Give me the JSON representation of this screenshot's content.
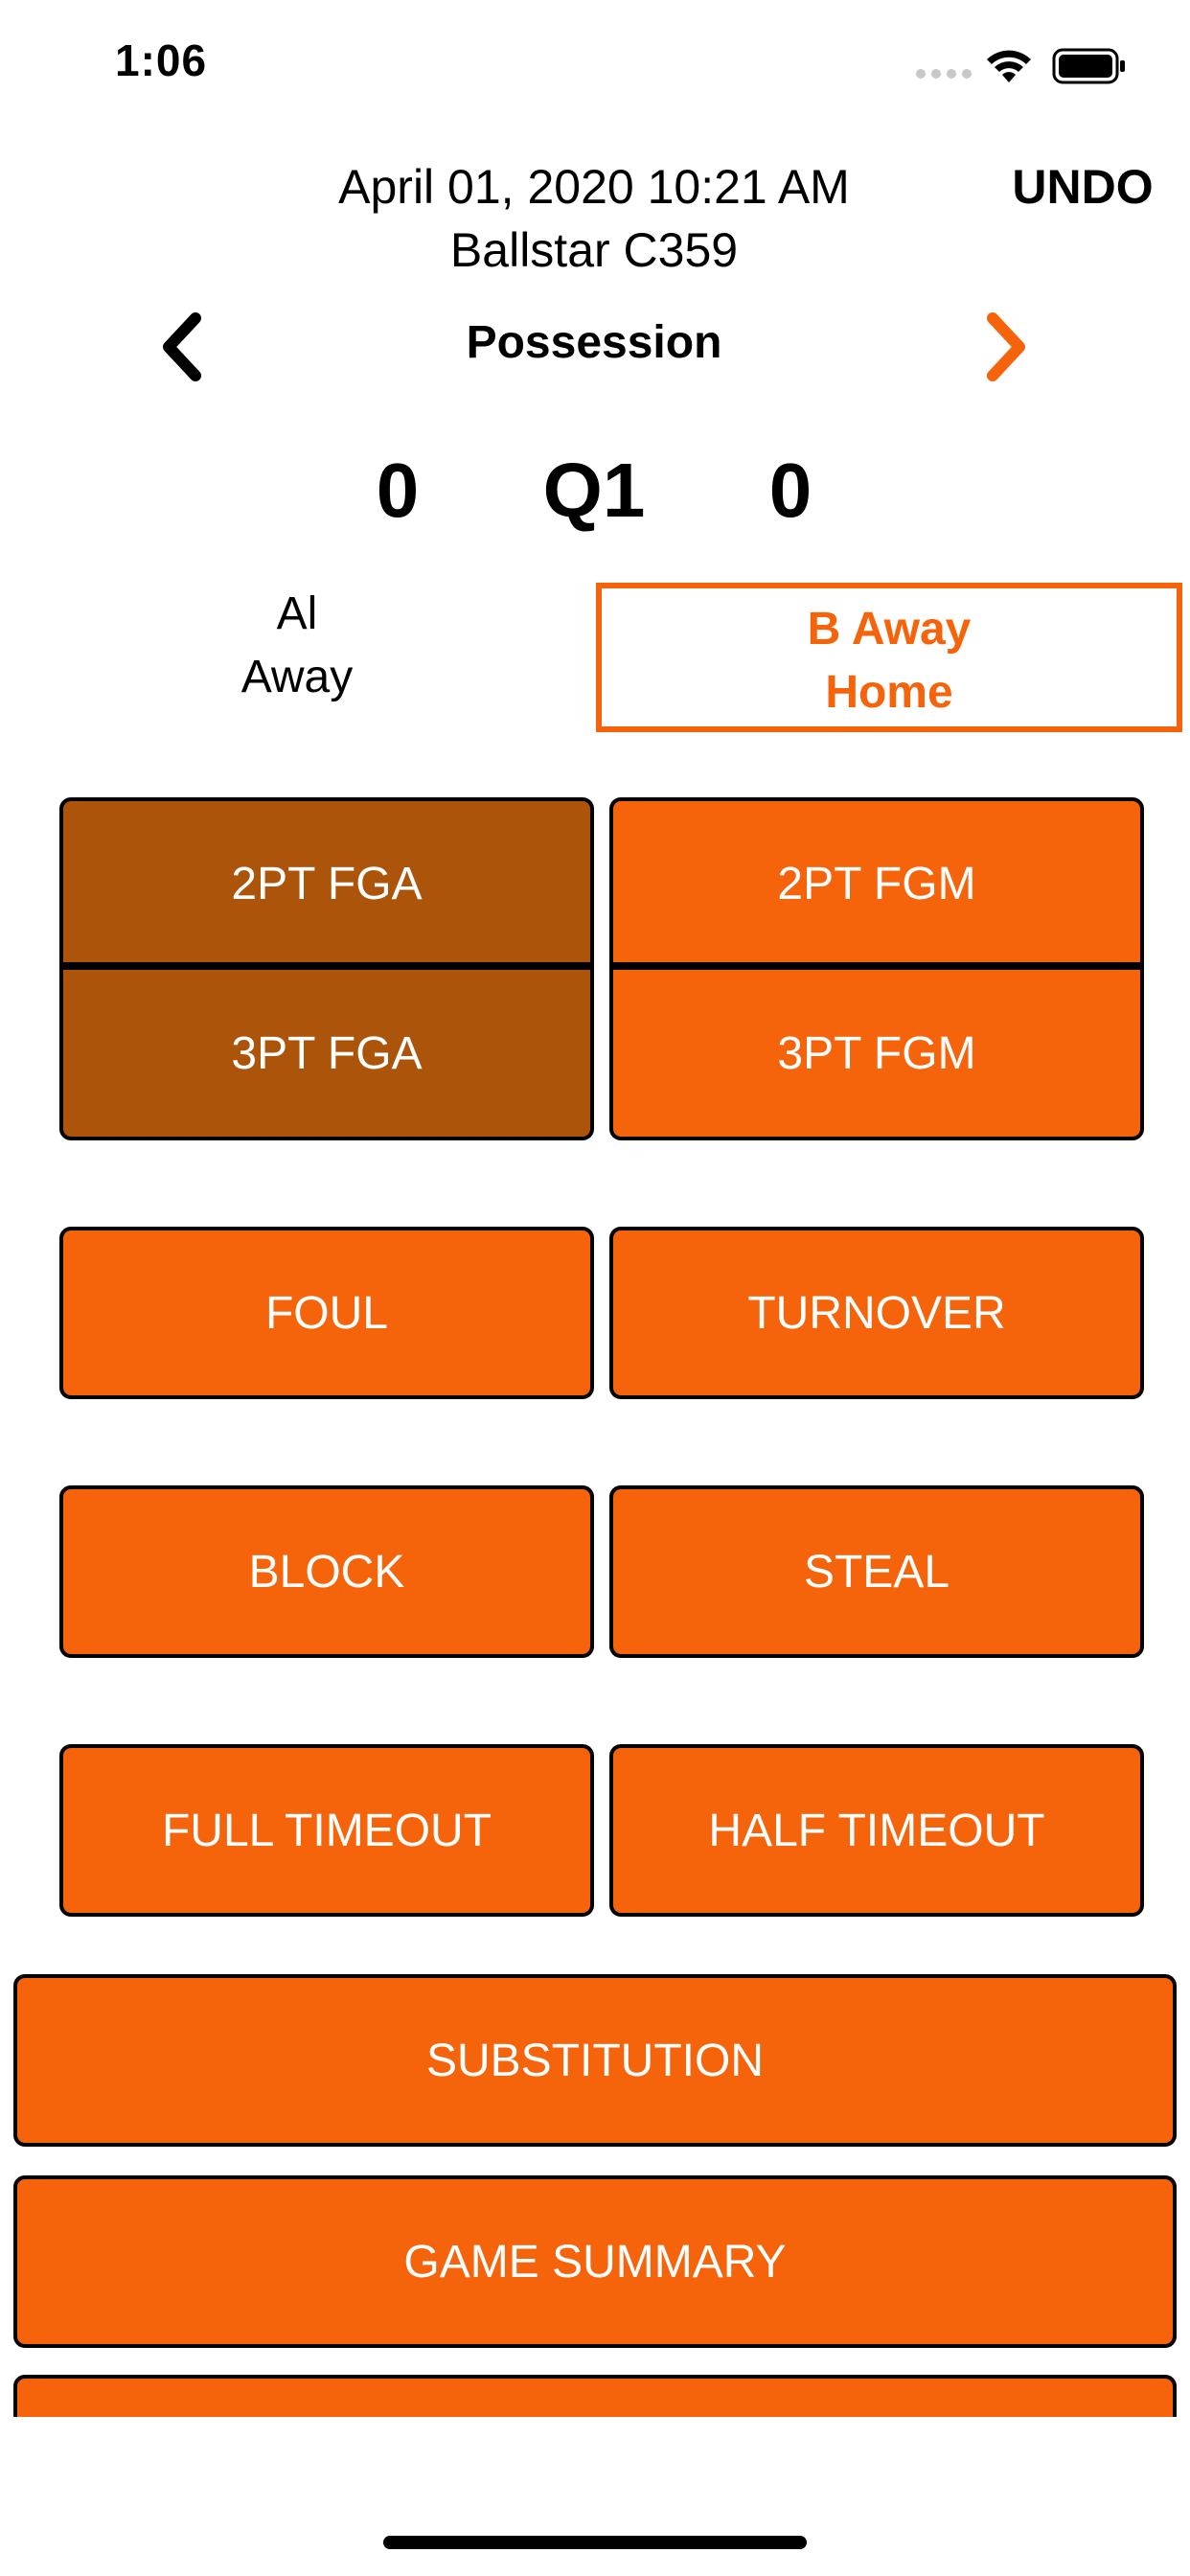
{
  "status_bar": {
    "time": "1:06"
  },
  "header": {
    "datetime": "April 01, 2020 10:21 AM",
    "venue": "Ballstar C359",
    "undo_label": "UNDO",
    "possession_label": "Possession"
  },
  "score": {
    "away": "0",
    "quarter": "Q1",
    "home": "0"
  },
  "teams": {
    "left": {
      "name": "Al",
      "role": "Away"
    },
    "right": {
      "name": "B Away",
      "role": "Home"
    }
  },
  "actions": {
    "fga_2pt": "2PT FGA",
    "fga_3pt": "3PT FGA",
    "fgm_2pt": "2PT FGM",
    "fgm_3pt": "3PT FGM",
    "foul": "FOUL",
    "turnover": "TURNOVER",
    "block": "BLOCK",
    "steal": "STEAL",
    "full_timeout": "FULL TIMEOUT",
    "half_timeout": "HALF TIMEOUT",
    "substitution": "SUBSTITUTION",
    "game_summary": "GAME SUMMARY"
  },
  "colors": {
    "accent": "#f5640a",
    "accent_dark": "#ad540b",
    "border": "#000000"
  }
}
